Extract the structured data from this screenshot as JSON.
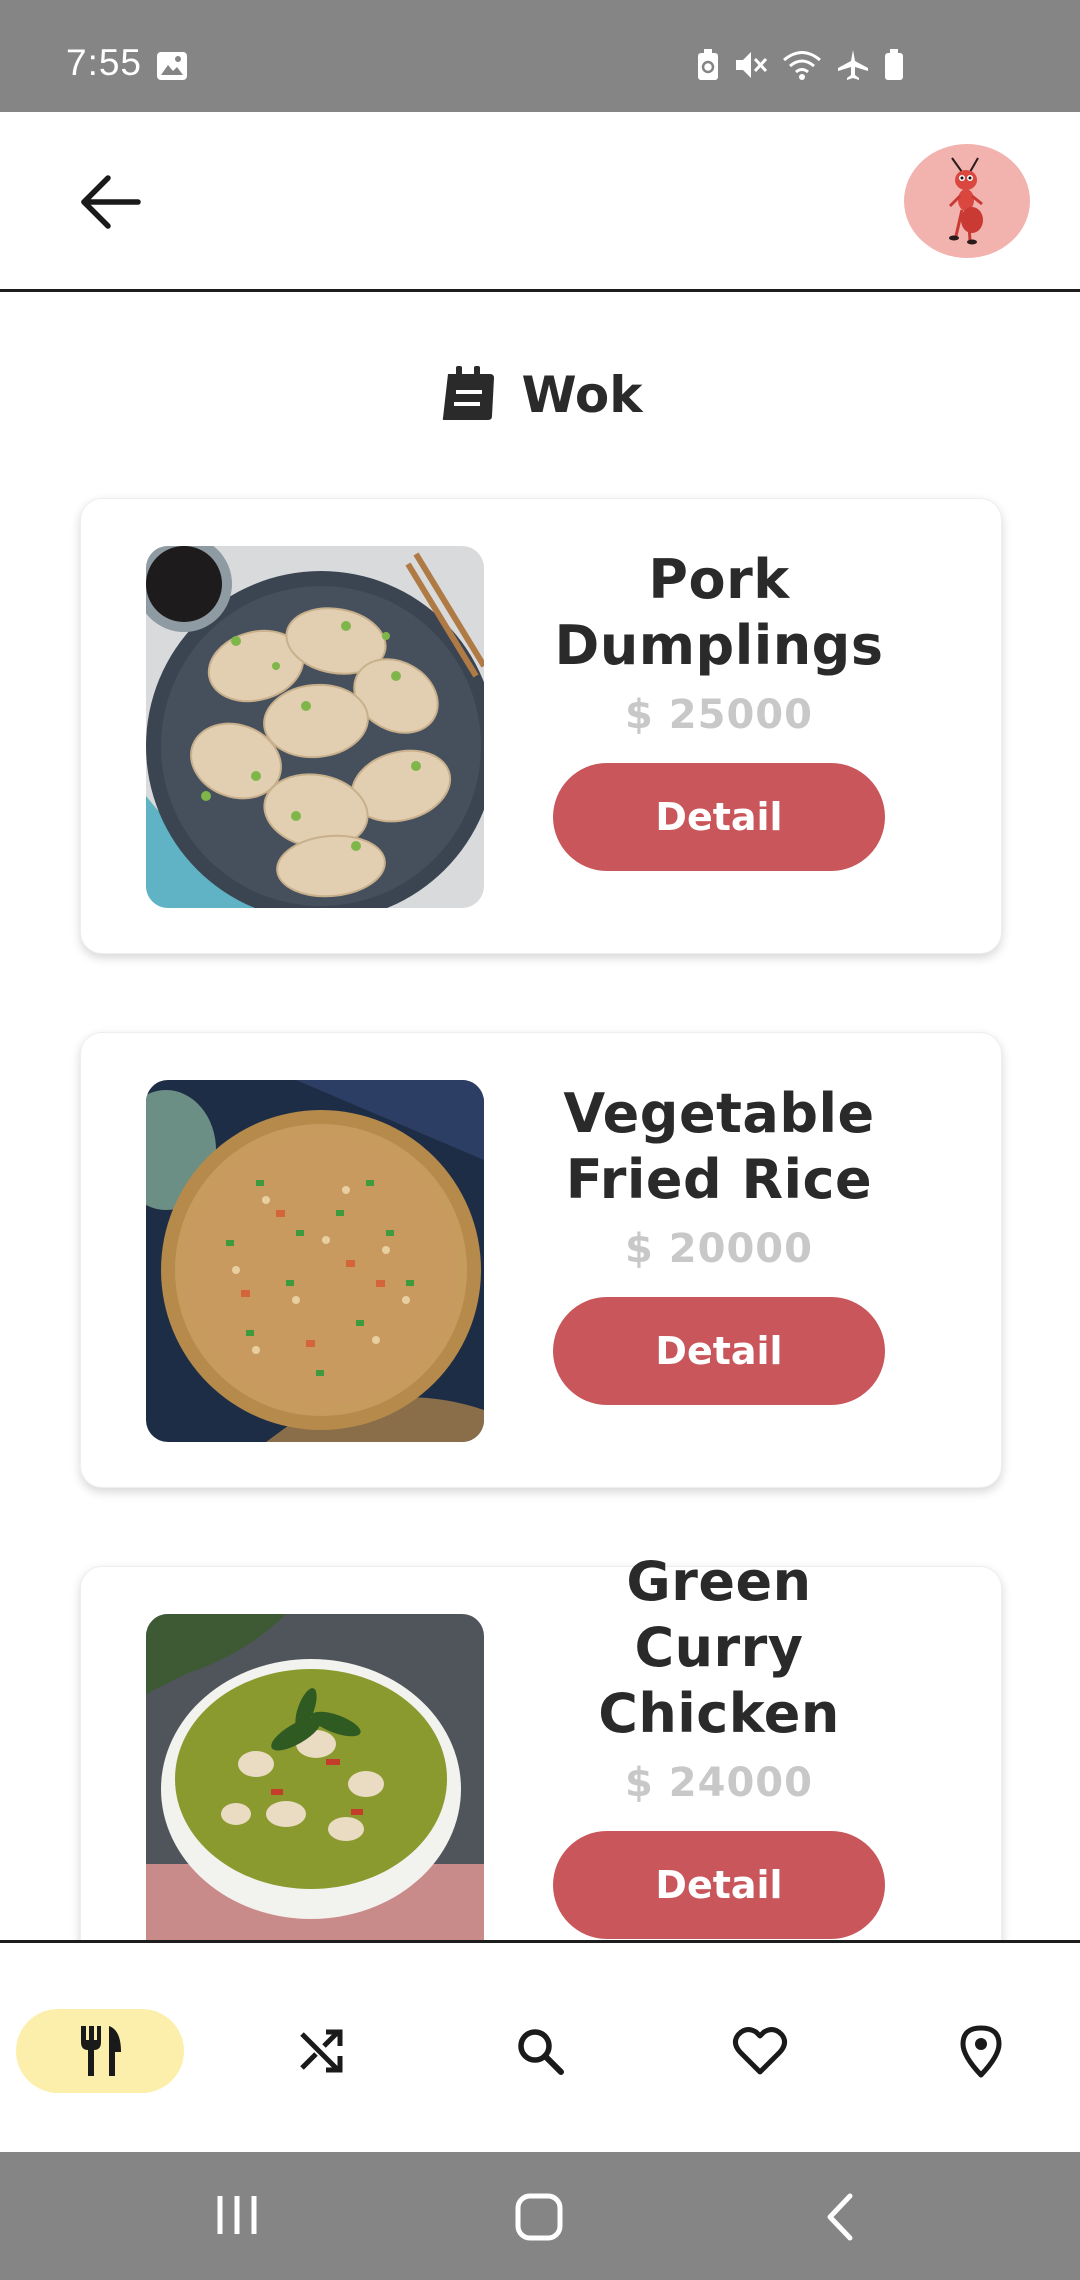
{
  "status_bar": {
    "time": "7:55",
    "icons": [
      "gallery-icon",
      "data-saver-icon",
      "mute-icon",
      "wifi-icon",
      "airplane-icon",
      "battery-icon"
    ]
  },
  "app_bar": {
    "back_icon": "arrow-left-icon",
    "avatar": "ant-mascot-avatar"
  },
  "page": {
    "icon": "menu-notebook-icon",
    "title": "Wok"
  },
  "dishes": [
    {
      "name": "Pork Dumplings",
      "price": "$ 25000",
      "button": "Detail"
    },
    {
      "name": "Vegetable Fried Rice",
      "price": "$ 20000",
      "button": "Detail"
    },
    {
      "name": "Green Curry Chicken",
      "price": "$ 24000",
      "button": "Detail"
    }
  ],
  "bottom_nav": {
    "items": [
      {
        "icon": "fork-knife-icon",
        "active": true
      },
      {
        "icon": "shuffle-icon",
        "active": false
      },
      {
        "icon": "search-icon",
        "active": false
      },
      {
        "icon": "heart-icon",
        "active": false
      },
      {
        "icon": "location-pin-icon",
        "active": false
      }
    ]
  },
  "system_nav": {
    "items": [
      "recent-apps-icon",
      "home-icon",
      "system-back-icon"
    ]
  },
  "colors": {
    "accent": "#C9565A",
    "active_nav": "#FBEFAB",
    "avatar_bg": "#F2B2AE",
    "price": "#C8C8C8",
    "system_bars": "#858585"
  }
}
